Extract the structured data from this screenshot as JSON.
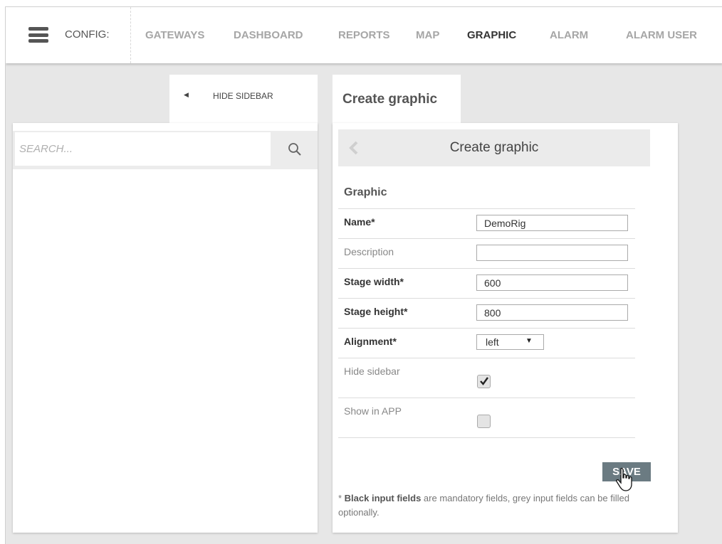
{
  "header": {
    "config_label": "CONFIG:",
    "nav": [
      "GATEWAYS",
      "DASHBOARD",
      "REPORTS",
      "MAP",
      "GRAPHIC",
      "ALARM",
      "ALARM USER"
    ],
    "active": "GRAPHIC"
  },
  "sidebar": {
    "toggle_label": "HIDE SIDEBAR",
    "search_placeholder": "SEARCH..."
  },
  "main": {
    "tab_title": "Create graphic",
    "card_title": "Create graphic",
    "section_title": "Graphic",
    "fields": {
      "name": {
        "label": "Name*",
        "value": "DemoRig"
      },
      "description": {
        "label": "Description",
        "value": ""
      },
      "stage_width": {
        "label": "Stage width*",
        "value": "600"
      },
      "stage_height": {
        "label": "Stage height*",
        "value": "800"
      },
      "alignment": {
        "label": "Alignment*",
        "value": "left"
      },
      "hide_sidebar": {
        "label": "Hide sidebar",
        "checked": true
      },
      "show_in_app": {
        "label": "Show in APP",
        "checked": false
      }
    },
    "save_label": "SAVE",
    "note_bold": "Black input fields",
    "note_text": " are mandatory fields, grey input fields can be filled optionally.",
    "note_prefix": "* "
  },
  "colors": {
    "background": "#e7e7e7",
    "save_button": "#6b7b82",
    "active_nav": "#333333",
    "inactive_nav": "#a6a6a6"
  }
}
